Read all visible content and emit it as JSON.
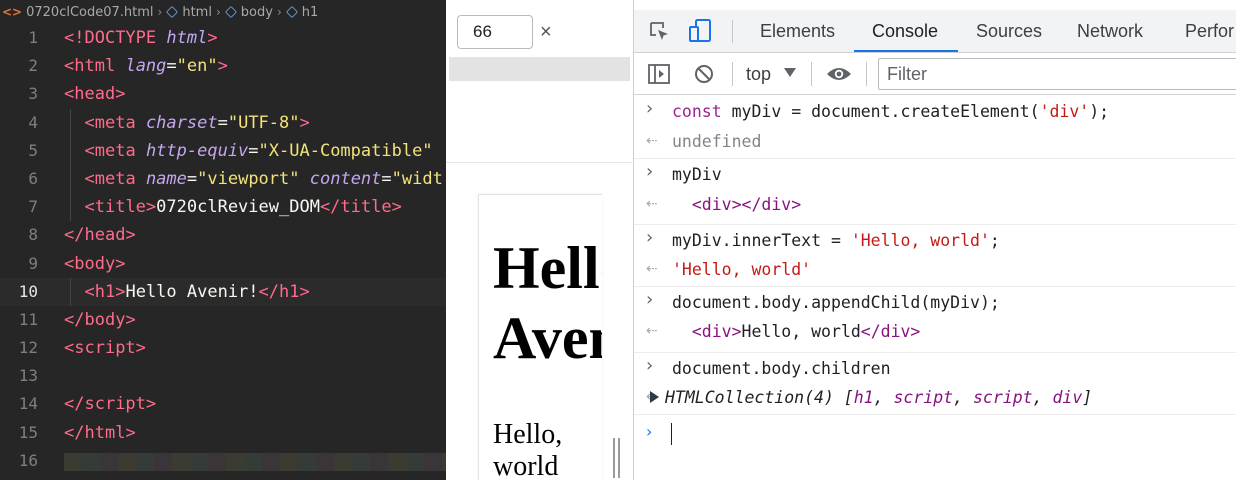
{
  "editor": {
    "breadcrumb": {
      "file": "0720clCode07.html",
      "items": [
        "html",
        "body",
        "h1"
      ]
    },
    "current_line": 10,
    "lines": [
      {
        "n": "1",
        "tokens": [
          [
            "p",
            "<!"
          ],
          [
            "tag",
            "DOCTYPE"
          ],
          [
            "t",
            " "
          ],
          [
            "attr",
            "html"
          ],
          [
            "p",
            ">"
          ]
        ]
      },
      {
        "n": "2",
        "tokens": [
          [
            "p",
            "<"
          ],
          [
            "tag",
            "html"
          ],
          [
            "t",
            " "
          ],
          [
            "attr",
            "lang"
          ],
          [
            "e",
            "="
          ],
          [
            "s",
            "\"en\""
          ],
          [
            "p",
            ">"
          ]
        ]
      },
      {
        "n": "3",
        "tokens": [
          [
            "p",
            "<"
          ],
          [
            "tag",
            "head"
          ],
          [
            "p",
            ">"
          ]
        ]
      },
      {
        "n": "4",
        "tokens": [
          [
            "t",
            "  "
          ],
          [
            "p",
            "<"
          ],
          [
            "tag",
            "meta"
          ],
          [
            "t",
            " "
          ],
          [
            "attr",
            "charset"
          ],
          [
            "e",
            "="
          ],
          [
            "s",
            "\"UTF-8\""
          ],
          [
            "p",
            ">"
          ]
        ]
      },
      {
        "n": "5",
        "tokens": [
          [
            "t",
            "  "
          ],
          [
            "p",
            "<"
          ],
          [
            "tag",
            "meta"
          ],
          [
            "t",
            " "
          ],
          [
            "attr",
            "http-equiv"
          ],
          [
            "e",
            "="
          ],
          [
            "s",
            "\"X-UA-Compatible\""
          ]
        ]
      },
      {
        "n": "6",
        "tokens": [
          [
            "t",
            "  "
          ],
          [
            "p",
            "<"
          ],
          [
            "tag",
            "meta"
          ],
          [
            "t",
            " "
          ],
          [
            "attr",
            "name"
          ],
          [
            "e",
            "="
          ],
          [
            "s",
            "\"viewport\""
          ],
          [
            "t",
            " "
          ],
          [
            "attr",
            "content"
          ],
          [
            "e",
            "="
          ],
          [
            "s",
            "\"widt"
          ]
        ]
      },
      {
        "n": "7",
        "tokens": [
          [
            "t",
            "  "
          ],
          [
            "p",
            "<"
          ],
          [
            "tag",
            "title"
          ],
          [
            "p",
            ">"
          ],
          [
            "t",
            "0720clReview_DOM"
          ],
          [
            "p",
            "</"
          ],
          [
            "tag",
            "title"
          ],
          [
            "p",
            ">"
          ]
        ]
      },
      {
        "n": "8",
        "tokens": [
          [
            "p",
            "</"
          ],
          [
            "tag",
            "head"
          ],
          [
            "p",
            ">"
          ]
        ]
      },
      {
        "n": "9",
        "tokens": [
          [
            "p",
            "<"
          ],
          [
            "tag",
            "body"
          ],
          [
            "p",
            ">"
          ]
        ]
      },
      {
        "n": "10",
        "tokens": [
          [
            "t",
            "  "
          ],
          [
            "p",
            "<"
          ],
          [
            "tag",
            "h1"
          ],
          [
            "p",
            ">"
          ],
          [
            "t",
            "Hello Avenir!"
          ],
          [
            "p",
            "</"
          ],
          [
            "tag",
            "h1"
          ],
          [
            "p",
            ">"
          ]
        ]
      },
      {
        "n": "11",
        "tokens": [
          [
            "p",
            "</"
          ],
          [
            "tag",
            "body"
          ],
          [
            "p",
            ">"
          ]
        ]
      },
      {
        "n": "12",
        "tokens": [
          [
            "p",
            "<"
          ],
          [
            "tag",
            "script"
          ],
          [
            "p",
            ">"
          ]
        ]
      },
      {
        "n": "13",
        "tokens": []
      },
      {
        "n": "14",
        "tokens": [
          [
            "p",
            "</"
          ],
          [
            "tag",
            "script"
          ],
          [
            "p",
            ">"
          ]
        ]
      },
      {
        "n": "15",
        "tokens": [
          [
            "p",
            "</"
          ],
          [
            "tag",
            "html"
          ],
          [
            "p",
            ">"
          ]
        ]
      },
      {
        "n": "16",
        "tokens": []
      }
    ]
  },
  "preview": {
    "width_value": "66",
    "close_symbol": "×",
    "h1_text": "Hello Avenir!",
    "div_text": "Hello, world"
  },
  "devtools": {
    "tabs": [
      "Elements",
      "Console",
      "Sources",
      "Network",
      "Perfor"
    ],
    "active_tab": "Console",
    "toolbar": {
      "context": "top",
      "filter_placeholder": "Filter"
    },
    "icons": {
      "inspect": "inspect-element-icon",
      "device": "device-toolbar-icon",
      "sidebar": "console-sidebar-icon",
      "clear": "clear-console-icon",
      "eye": "live-expression-icon"
    },
    "accent_color": "#1a73e8",
    "console": [
      {
        "kind": "input",
        "parts": [
          [
            "kw",
            "const"
          ],
          [
            "plain",
            " myDiv = document.createElement("
          ],
          [
            "str",
            "'div'"
          ],
          [
            "plain",
            ");"
          ]
        ]
      },
      {
        "kind": "result",
        "parts": [
          [
            "undef",
            "undefined"
          ]
        ]
      },
      {
        "kind": "input",
        "parts": [
          [
            "plain",
            "myDiv"
          ]
        ]
      },
      {
        "kind": "result",
        "parts": [
          [
            "plain",
            "  "
          ],
          [
            "el",
            "<div></div>"
          ]
        ]
      },
      {
        "kind": "input",
        "parts": [
          [
            "plain",
            "myDiv.innerText = "
          ],
          [
            "str",
            "'Hello, world'"
          ],
          [
            "plain",
            ";"
          ]
        ]
      },
      {
        "kind": "result",
        "parts": [
          [
            "str",
            "'Hello, world'"
          ]
        ]
      },
      {
        "kind": "input",
        "parts": [
          [
            "plain",
            "document.body.appendChild(myDiv);"
          ]
        ]
      },
      {
        "kind": "result",
        "parts": [
          [
            "plain",
            "  "
          ],
          [
            "el",
            "<div>"
          ],
          [
            "plain",
            "Hello, world"
          ],
          [
            "el",
            "</div>"
          ]
        ]
      },
      {
        "kind": "input",
        "parts": [
          [
            "plain",
            "document.body.children"
          ]
        ]
      },
      {
        "kind": "result-collection",
        "parts": [
          [
            "ital",
            "HTMLCollection(4) ["
          ],
          [
            "itag",
            "h1"
          ],
          [
            "ital",
            ", "
          ],
          [
            "itag",
            "script"
          ],
          [
            "ital",
            ", "
          ],
          [
            "itag",
            "script"
          ],
          [
            "ital",
            ", "
          ],
          [
            "itag",
            "div"
          ],
          [
            "ital",
            "]"
          ]
        ]
      }
    ]
  }
}
